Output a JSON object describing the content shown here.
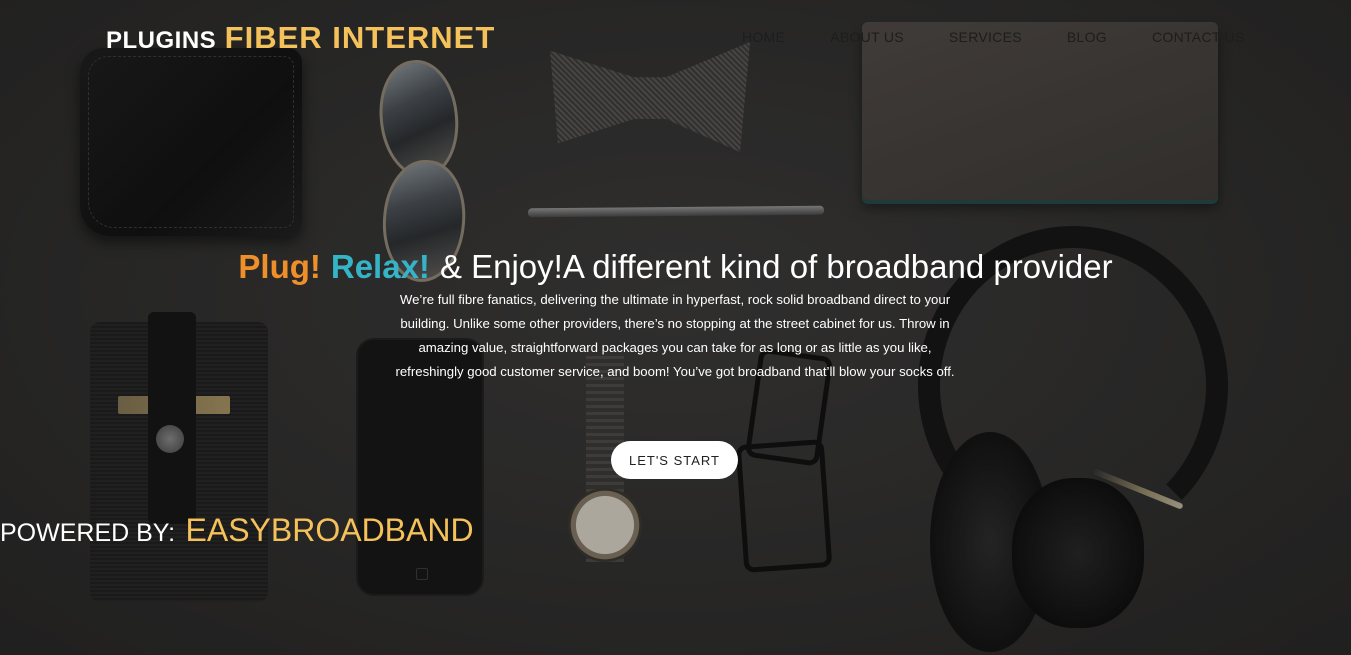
{
  "header": {
    "brand_prefix": "PLUGINS",
    "brand_name": "FIBER INTERNET",
    "nav": [
      "HOME",
      "ABOUT US",
      "SERVICES",
      "BLOG",
      "CONTACT US"
    ]
  },
  "hero": {
    "headline_1": "Plug!",
    "headline_2": "Relax!",
    "headline_3": "& Enjoy!A different kind of broadband provider",
    "description": "We’re full fibre fanatics, delivering the ultimate in hyperfast, rock solid broadband direct to your building. Unlike some other providers, there’s no stopping at the street cabinet for us. Throw in amazing value, straightforward packages you can take for as long or as little as you like, refreshingly good customer service, and boom! You’ve got broadband that’ll blow your socks off.",
    "cta_label": "LET'S START"
  },
  "footer": {
    "powered_label": "POWERED BY:",
    "powered_name": "EASYBROADBAND"
  },
  "colors": {
    "brand_accent": "#f4c15a",
    "headline_orange": "#ef8f2a",
    "headline_teal": "#35b4c8"
  }
}
